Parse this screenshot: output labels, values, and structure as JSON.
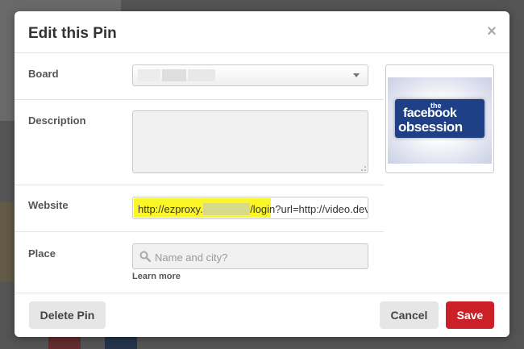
{
  "modal": {
    "title": "Edit this Pin",
    "close_label": "×"
  },
  "form": {
    "board": {
      "label": "Board",
      "selected_value": ""
    },
    "description": {
      "label": "Description",
      "value": ""
    },
    "website": {
      "label": "Website",
      "url_part1": "http://ezproxy.",
      "url_part2": "/login?",
      "url_part3": "url=http://video.dev.i"
    },
    "place": {
      "label": "Place",
      "placeholder": "Name and city?",
      "learn_more": "Learn more"
    }
  },
  "preview": {
    "line1": "the",
    "line2": "facebook",
    "line3": "obsession"
  },
  "footer": {
    "delete_label": "Delete Pin",
    "cancel_label": "Cancel",
    "save_label": "Save"
  },
  "colors": {
    "primary_red": "#cb2027",
    "highlight_yellow": "#fbf62a",
    "facebook_blue": "#1f3f86"
  }
}
